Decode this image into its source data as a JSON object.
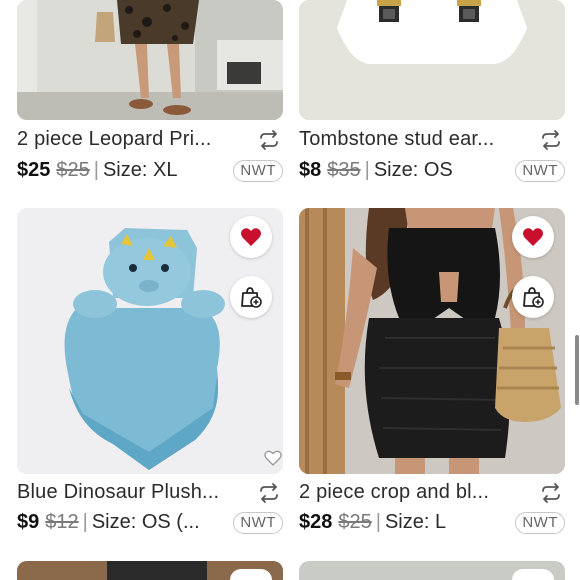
{
  "listings": [
    {
      "title": "2 piece Leopard Pri...",
      "price": "$25",
      "original_price": "$25",
      "size": "Size: XL",
      "condition": "NWT"
    },
    {
      "title": "Tombstone stud ear...",
      "price": "$8",
      "original_price": "$35",
      "size": "Size: OS",
      "condition": "NWT"
    },
    {
      "title": "Blue Dinosaur Plush...",
      "price": "$9",
      "original_price": "$12",
      "size": "Size: OS (...",
      "condition": "NWT",
      "liked": true
    },
    {
      "title": "2 piece crop and bl...",
      "price": "$28",
      "original_price": "$25",
      "size": "Size: L",
      "condition": "NWT",
      "liked": true
    }
  ],
  "colors": {
    "heart_red": "#c8102e",
    "plush_blue": "#8fc3d6",
    "dress_black": "#1a1a1a"
  },
  "separator": "|"
}
